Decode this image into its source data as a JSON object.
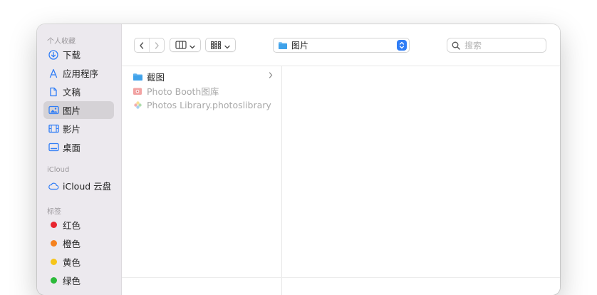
{
  "sidebar": {
    "sections": [
      {
        "title": "个人收藏"
      },
      {
        "title": "iCloud"
      },
      {
        "title": "标签"
      }
    ],
    "favorites": [
      {
        "label": "下载",
        "icon": "download-icon"
      },
      {
        "label": "应用程序",
        "icon": "applications-icon"
      },
      {
        "label": "文稿",
        "icon": "document-icon"
      },
      {
        "label": "图片",
        "icon": "pictures-icon",
        "selected": true
      },
      {
        "label": "影片",
        "icon": "film-icon"
      },
      {
        "label": "桌面",
        "icon": "desktop-icon"
      }
    ],
    "icloud": [
      {
        "label": "iCloud 云盘",
        "icon": "cloud-icon"
      }
    ],
    "tags": [
      {
        "label": "红色",
        "color": "#e8262f"
      },
      {
        "label": "橙色",
        "color": "#f5821f"
      },
      {
        "label": "黄色",
        "color": "#f6c51a"
      },
      {
        "label": "绿色",
        "color": "#2cba3a"
      }
    ]
  },
  "toolbar": {
    "location": "图片",
    "search_placeholder": "搜索",
    "accent": "#2f7df6"
  },
  "files": [
    {
      "name": "截图",
      "icon": "folder-icon",
      "has_children": true,
      "dimmed": false
    },
    {
      "name": "Photo Booth图库",
      "icon": "photo-booth-icon",
      "dimmed": true
    },
    {
      "name": "Photos Library.photoslibrary",
      "icon": "photos-library-icon",
      "dimmed": true
    }
  ]
}
